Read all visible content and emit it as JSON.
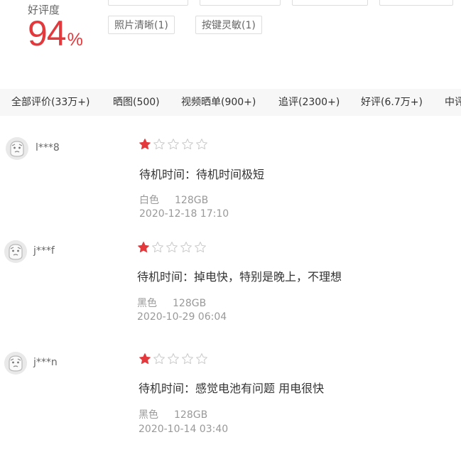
{
  "rating": {
    "label": "好评度",
    "value": "94",
    "percent_sign": "%"
  },
  "tags": [
    "照片清晰(1)",
    "按键灵敏(1)"
  ],
  "filters": [
    "全部评价(33万+)",
    "晒图(500)",
    "视频晒单(900+)",
    "追评(2300+)",
    "好评(6.7万+)",
    "中评"
  ],
  "reviews": [
    {
      "user": "l***8",
      "stars": 1,
      "comment": "待机时间：待机时间极短",
      "color": "白色",
      "storage": "128GB",
      "date": "2020-12-18 17:10"
    },
    {
      "user": "j***f",
      "stars": 1,
      "comment": "待机时间：掉电快，特别是晚上，不理想",
      "color": "黑色",
      "storage": "128GB",
      "date": "2020-10-29 06:04"
    },
    {
      "user": "j***n",
      "stars": 1,
      "comment": "待机时间：感觉电池有问题 用电很快",
      "color": "黑色",
      "storage": "128GB",
      "date": "2020-10-14 03:40"
    }
  ],
  "colors": {
    "accent": "#e4393c",
    "star_empty": "#cccccc",
    "filter_bg": "#f7f7f7",
    "muted_text": "#999999"
  },
  "icons": {
    "avatar": "default-face-avatar-icon",
    "star_filled": "star-filled-icon",
    "star_empty": "star-outline-icon"
  }
}
